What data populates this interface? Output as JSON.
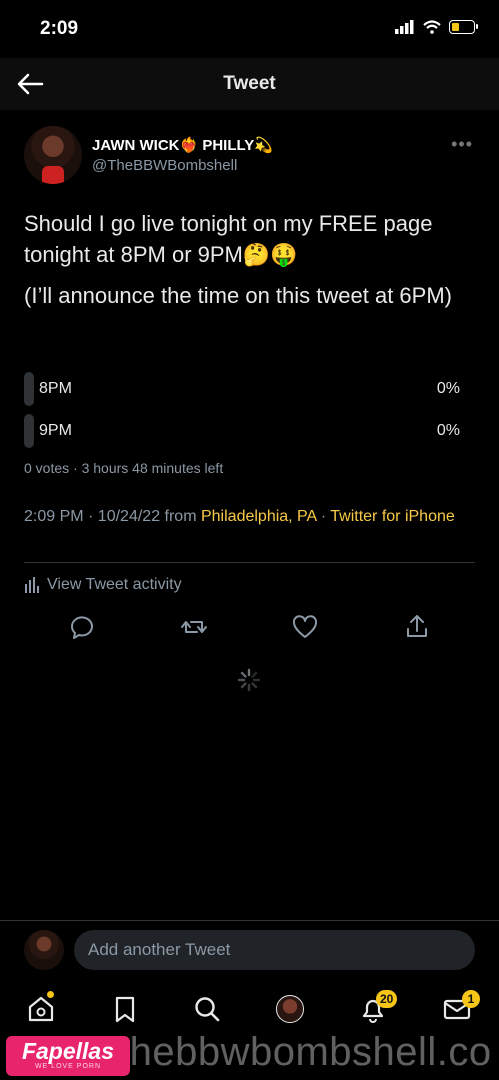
{
  "status_bar": {
    "time": "2:09"
  },
  "header": {
    "title": "Tweet"
  },
  "tweet": {
    "display_name": "JAWN WICK❤️‍🔥 PHILLY💫",
    "handle": "@TheBBWBombshell",
    "text_line1": "Should I go live tonight on my FREE page tonight at 8PM or 9PM🤔🤑",
    "text_line2": "(I’ll announce the time on this tweet at 6PM)",
    "poll": {
      "options": [
        {
          "label": "8PM",
          "percent": "0%",
          "value": 0
        },
        {
          "label": "9PM",
          "percent": "0%",
          "value": 0
        }
      ],
      "meta": "0 votes · 3 hours 48 minutes left"
    },
    "timestamp": "2:09 PM · 10/24/22 from ",
    "location": "Philadelphia, PA",
    "separator": " · ",
    "source": "Twitter for iPhone",
    "activity_label": "View Tweet activity"
  },
  "reply": {
    "placeholder": "Add another Tweet"
  },
  "nav": {
    "notifications_badge": "20",
    "messages_badge": "1"
  },
  "watermark": {
    "logo": "Fapellas",
    "logo_sub": "WE LOVE PORN",
    "text": "thebbwbombshell.co"
  },
  "colors": {
    "accent": "#f7c948",
    "badge": "#f5c518",
    "background": "#000000"
  }
}
